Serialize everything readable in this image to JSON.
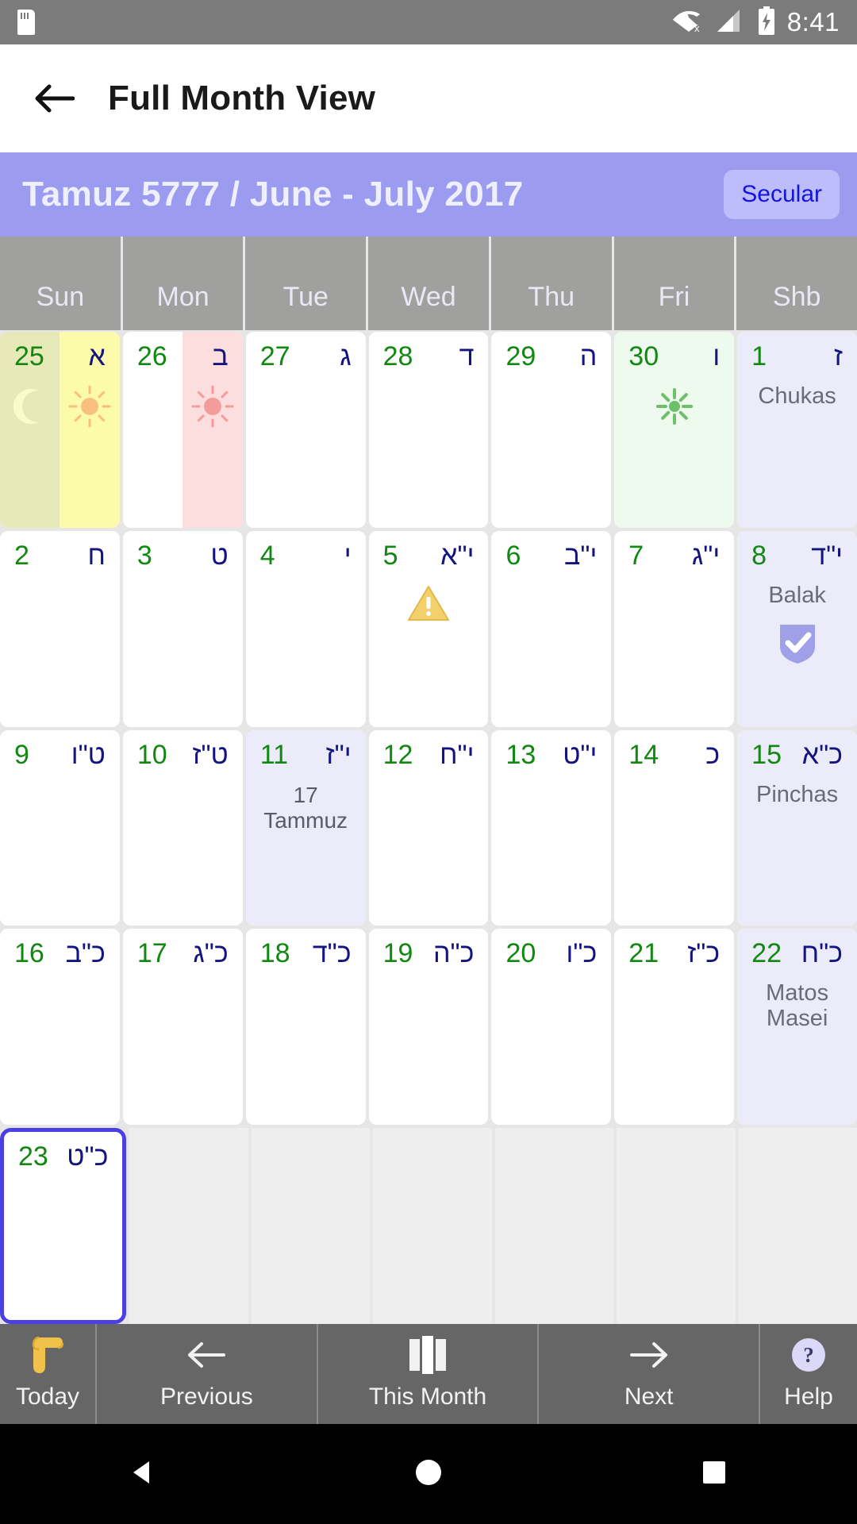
{
  "statusbar": {
    "time": "8:41",
    "icons": [
      "sd-card-icon",
      "wifi-off-icon",
      "signal-icon",
      "battery-charging-icon"
    ]
  },
  "appbar": {
    "back_icon": "arrow-left-icon",
    "title": "Full Month View"
  },
  "month_banner": {
    "title": "Tamuz 5777 / June - July 2017",
    "secular_button": "Secular",
    "bg_color": "#9b9bf0",
    "button_bg": "#bdbdfb",
    "button_text_color": "#1414e0"
  },
  "weekdays": [
    "Sun",
    "Mon",
    "Tue",
    "Wed",
    "Thu",
    "Fri",
    "Shb"
  ],
  "colors": {
    "gregorian": "#118811",
    "hebrew": "#141480",
    "shabbat_bg": "#ebebfa",
    "erev_shabbat_bg": "#effaef",
    "molad_left_bg": "#e8e9b8",
    "molad_right_bg": "#fbfbab",
    "fast_bg": "#fcdedf",
    "selected_border": "#4b3fe4",
    "grid_bg": "#e6e6e6"
  },
  "weeks": [
    [
      {
        "greg": "25",
        "heb": "א",
        "bg_left": "#e8e9b8",
        "bg_right": "#fbfbab",
        "icon_left": "moon-icon",
        "icon_right": "sun-orange-icon"
      },
      {
        "greg": "26",
        "heb": "ב",
        "bg_left": "#ffffff",
        "bg_right": "#fcdedf",
        "icon_right": "sun-pink-icon"
      },
      {
        "greg": "27",
        "heb": "ג",
        "bg_left": "#ffffff",
        "bg_right": "#ffffff"
      },
      {
        "greg": "28",
        "heb": "ד",
        "bg_left": "#ffffff",
        "bg_right": "#ffffff"
      },
      {
        "greg": "29",
        "heb": "ה",
        "bg_left": "#ffffff",
        "bg_right": "#ffffff"
      },
      {
        "greg": "30",
        "heb": "ו",
        "bg_left": "#effaef",
        "bg_right": "#effaef",
        "icon_center": "sun-green-icon"
      },
      {
        "greg": "1",
        "heb": "ז",
        "bg_left": "#ebebfa",
        "bg_right": "#ebebfa",
        "parsha": "Chukas"
      }
    ],
    [
      {
        "greg": "2",
        "heb": "ח",
        "bg_left": "#ffffff",
        "bg_right": "#ffffff"
      },
      {
        "greg": "3",
        "heb": "ט",
        "bg_left": "#ffffff",
        "bg_right": "#ffffff"
      },
      {
        "greg": "4",
        "heb": "י",
        "bg_left": "#ffffff",
        "bg_right": "#ffffff"
      },
      {
        "greg": "5",
        "heb": "י\"א",
        "bg_left": "#ffffff",
        "bg_right": "#ffffff",
        "icon_center": "warning-triangle-icon"
      },
      {
        "greg": "6",
        "heb": "י\"ב",
        "bg_left": "#ffffff",
        "bg_right": "#ffffff"
      },
      {
        "greg": "7",
        "heb": "י\"ג",
        "bg_left": "#ffffff",
        "bg_right": "#ffffff"
      },
      {
        "greg": "8",
        "heb": "י\"ד",
        "bg_left": "#ebebfa",
        "bg_right": "#ebebfa",
        "parsha": "Balak",
        "icon_below": "shield-check-icon"
      }
    ],
    [
      {
        "greg": "9",
        "heb": "ט\"ו",
        "bg_left": "#ffffff",
        "bg_right": "#ffffff"
      },
      {
        "greg": "10",
        "heb": "ט\"ז",
        "bg_left": "#ffffff",
        "bg_right": "#ffffff"
      },
      {
        "greg": "11",
        "heb": "י\"ז",
        "bg_left": "#ebebfa",
        "bg_right": "#ebebfa",
        "note": "17\nTammuz"
      },
      {
        "greg": "12",
        "heb": "י\"ח",
        "bg_left": "#ffffff",
        "bg_right": "#ffffff"
      },
      {
        "greg": "13",
        "heb": "י\"ט",
        "bg_left": "#ffffff",
        "bg_right": "#ffffff"
      },
      {
        "greg": "14",
        "heb": "כ",
        "bg_left": "#ffffff",
        "bg_right": "#ffffff"
      },
      {
        "greg": "15",
        "heb": "כ\"א",
        "bg_left": "#ebebfa",
        "bg_right": "#ebebfa",
        "parsha": "Pinchas"
      }
    ],
    [
      {
        "greg": "16",
        "heb": "כ\"ב",
        "bg_left": "#ffffff",
        "bg_right": "#ffffff"
      },
      {
        "greg": "17",
        "heb": "כ\"ג",
        "bg_left": "#ffffff",
        "bg_right": "#ffffff"
      },
      {
        "greg": "18",
        "heb": "כ\"ד",
        "bg_left": "#ffffff",
        "bg_right": "#ffffff"
      },
      {
        "greg": "19",
        "heb": "כ\"ה",
        "bg_left": "#ffffff",
        "bg_right": "#ffffff"
      },
      {
        "greg": "20",
        "heb": "כ\"ו",
        "bg_left": "#ffffff",
        "bg_right": "#ffffff"
      },
      {
        "greg": "21",
        "heb": "כ\"ז",
        "bg_left": "#ffffff",
        "bg_right": "#ffffff"
      },
      {
        "greg": "22",
        "heb": "כ\"ח",
        "bg_left": "#ebebfa",
        "bg_right": "#ebebfa",
        "parsha": "Matos\nMasei"
      }
    ],
    [
      {
        "greg": "23",
        "heb": "כ\"ט",
        "bg_left": "#ffffff",
        "bg_right": "#ffffff",
        "selected": true
      },
      {
        "empty": true
      },
      {
        "empty": true
      },
      {
        "empty": true
      },
      {
        "empty": true
      },
      {
        "empty": true
      },
      {
        "empty": true
      }
    ]
  ],
  "toolbar": [
    {
      "label": "Today",
      "icon": "scroll-icon"
    },
    {
      "label": "Previous",
      "icon": "arrow-left-icon"
    },
    {
      "label": "This Month",
      "icon": "calendar-month-icon"
    },
    {
      "label": "Next",
      "icon": "arrow-right-icon"
    },
    {
      "label": "Help",
      "icon": "question-circle-icon"
    }
  ],
  "navbar": [
    {
      "name": "back-nav-button",
      "icon": "triangle-left-icon"
    },
    {
      "name": "home-nav-button",
      "icon": "circle-icon"
    },
    {
      "name": "recents-nav-button",
      "icon": "square-icon"
    }
  ]
}
